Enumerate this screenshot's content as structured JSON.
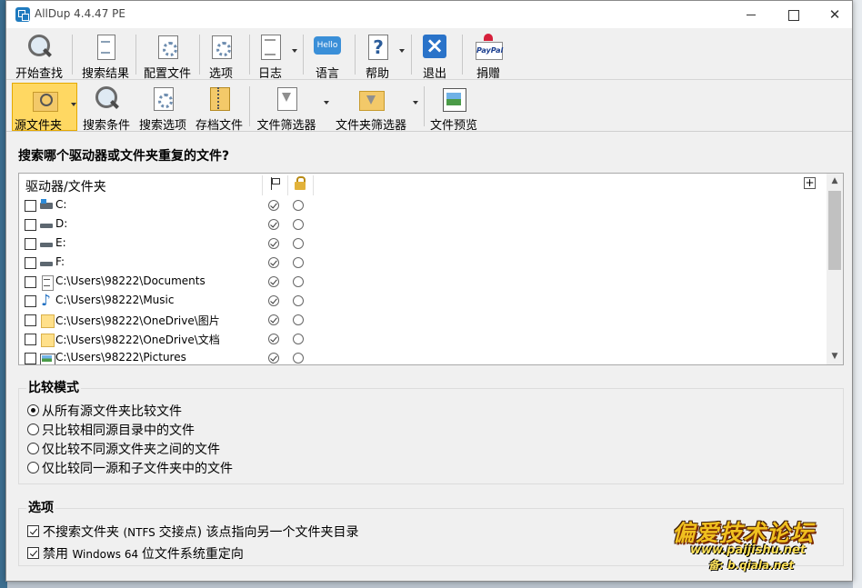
{
  "window": {
    "title": "AllDup 4.4.47 PE"
  },
  "toolbar1": [
    {
      "label": "开始查找",
      "icon": "magnifier-search-icon"
    },
    {
      "label": "搜索结果",
      "icon": "results-document-icon"
    },
    {
      "label": "配置文件",
      "icon": "profile-gear-icon"
    },
    {
      "label": "选项",
      "icon": "options-gear-icon"
    },
    {
      "label": "日志",
      "icon": "log-document-icon"
    },
    {
      "label": "语言",
      "icon": "hello-language-icon"
    },
    {
      "label": "帮助",
      "icon": "help-question-icon"
    },
    {
      "label": "退出",
      "icon": "exit-x-icon"
    },
    {
      "label": "捐赠",
      "icon": "paypal-donate-icon"
    }
  ],
  "toolbar2": [
    {
      "label": "源文件夹",
      "icon": "source-folder-icon",
      "active": true
    },
    {
      "label": "搜索条件",
      "icon": "search-criteria-icon"
    },
    {
      "label": "搜索选项",
      "icon": "search-options-gear-icon"
    },
    {
      "label": "存档文件",
      "icon": "archive-zip-icon"
    },
    {
      "label": "文件筛选器",
      "icon": "file-filter-icon"
    },
    {
      "label": "文件夹筛选器",
      "icon": "folder-filter-icon"
    },
    {
      "label": "文件预览",
      "icon": "file-preview-icon"
    }
  ],
  "main": {
    "heading": "搜索哪个驱动器或文件夹重复的文件?",
    "list_header": "驱动器/文件夹",
    "add_button": "+",
    "rows": [
      {
        "path": "C:",
        "icon": "system-drive-icon"
      },
      {
        "path": "D:",
        "icon": "drive-icon"
      },
      {
        "path": "E:",
        "icon": "drive-icon"
      },
      {
        "path": "F:",
        "icon": "drive-icon"
      },
      {
        "path": "C:\\Users\\98222\\Documents",
        "icon": "documents-icon"
      },
      {
        "path": "C:\\Users\\98222\\Music",
        "icon": "music-note-icon"
      },
      {
        "path": "C:\\Users\\98222\\OneDrive\\图片",
        "icon": "folder-icon"
      },
      {
        "path": "C:\\Users\\98222\\OneDrive\\文档",
        "icon": "folder-icon"
      },
      {
        "path": "C:\\Users\\98222\\Pictures",
        "icon": "pictures-icon"
      }
    ]
  },
  "compare": {
    "title": "比较模式",
    "options": [
      {
        "label": "从所有源文件夹比较文件",
        "selected": true
      },
      {
        "label": "只比较相同源目录中的文件",
        "selected": false
      },
      {
        "label": "仅比较不同源文件夹之间的文件",
        "selected": false
      },
      {
        "label": "仅比较同一源和子文件夹中的文件",
        "selected": false
      }
    ]
  },
  "options": {
    "title": "选项",
    "items": [
      {
        "pre": "不搜索文件夹 ",
        "small": "(NTFS ",
        "post": "交接点) 该点指向另一个文件夹目录",
        "checked": true
      },
      {
        "pre": "禁用 ",
        "small": "Windows 64 ",
        "post": "位文件系统重定向",
        "checked": true
      }
    ]
  },
  "watermark": {
    "main": "偏爱技术论坛",
    "url": "www.paijishu.net",
    "url2": "备: b.qiala.net"
  },
  "colors": {
    "active_button": "#ffd862",
    "window_bg": "#f0f0f0",
    "watermark": "#f0c020"
  }
}
